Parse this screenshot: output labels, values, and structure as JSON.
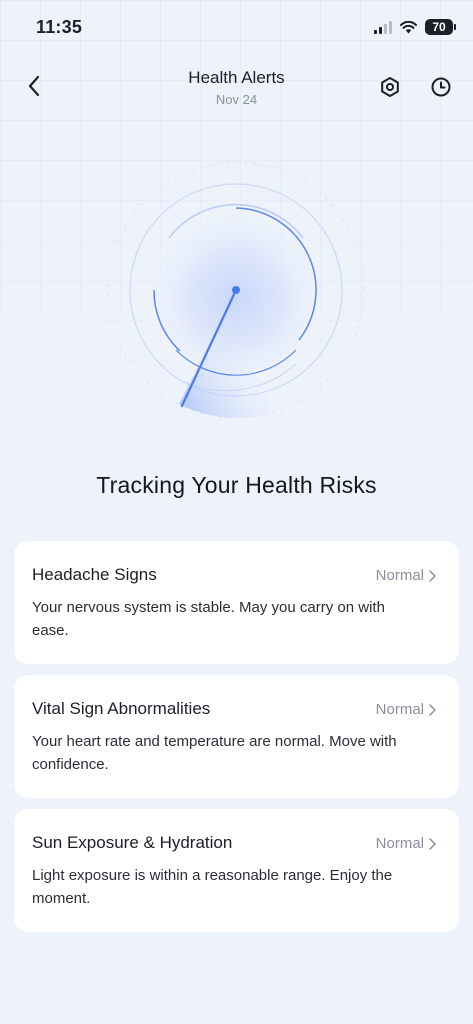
{
  "status_bar": {
    "time": "11:35",
    "battery": "70"
  },
  "header": {
    "title": "Health Alerts",
    "subtitle": "Nov 24"
  },
  "icons": {
    "back": "chevron-left-icon",
    "settings": "hexagon-settings-icon",
    "history": "clock-icon",
    "card_chevron": "chevron-right-icon"
  },
  "gauge": {
    "needle_angle_deg": 205
  },
  "section": {
    "heading": "Tracking Your Health Risks"
  },
  "cards": [
    {
      "title": "Headache Signs",
      "status": "Normal",
      "description": "Your nervous system is stable. May you carry on with ease."
    },
    {
      "title": "Vital Sign Abnormalities",
      "status": "Normal",
      "description": "Your heart rate and temperature are normal. Move with confidence."
    },
    {
      "title": "Sun Exposure & Hydration",
      "status": "Normal",
      "description": "Light exposure is within a reasonable range. Enjoy the moment."
    }
  ],
  "colors": {
    "accent": "#4a7bea",
    "background": "#edf2fb",
    "card": "#ffffff",
    "muted_text": "#8a909c"
  }
}
